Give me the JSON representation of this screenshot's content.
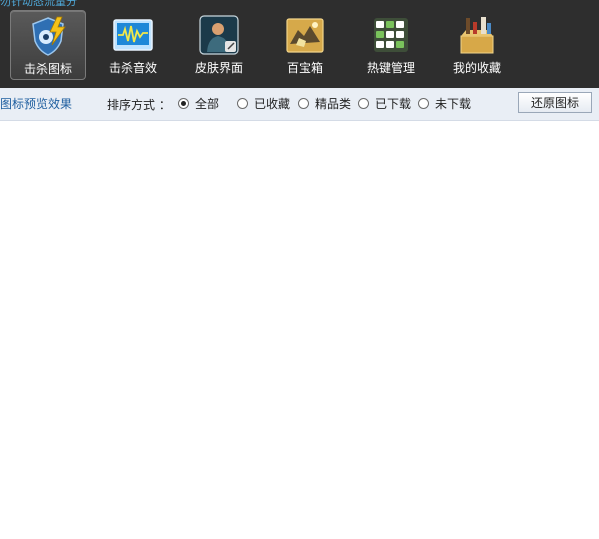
{
  "header": {
    "crumb_text": "勿针动态流量分",
    "tools": [
      {
        "label": "击杀图标",
        "icon": "shield-lightning-icon",
        "active": true
      },
      {
        "label": "击杀音效",
        "icon": "waveform-monitor-icon",
        "active": false
      },
      {
        "label": "皮肤界面",
        "icon": "soldier-skin-icon",
        "active": false
      },
      {
        "label": "百宝箱",
        "icon": "treasure-box-icon",
        "active": false
      },
      {
        "label": "热键管理",
        "icon": "keyboard-icon",
        "active": false
      },
      {
        "label": "我的收藏",
        "icon": "favorites-box-icon",
        "active": false
      }
    ]
  },
  "toolbar": {
    "preview_title": "图标预览效果",
    "sort_label": "排序方式 ：",
    "sort_options": [
      {
        "label": "全部",
        "selected": true
      },
      {
        "label": "已收藏",
        "selected": false
      },
      {
        "label": "精品类",
        "selected": false
      },
      {
        "label": "已下载",
        "selected": false
      },
      {
        "label": "未下载",
        "selected": false
      }
    ],
    "restore_button": "还原图标"
  },
  "colors": {
    "topbar": "#2e2e2e",
    "toolbar": "#e9eef5",
    "link": "#1f5fa0"
  }
}
